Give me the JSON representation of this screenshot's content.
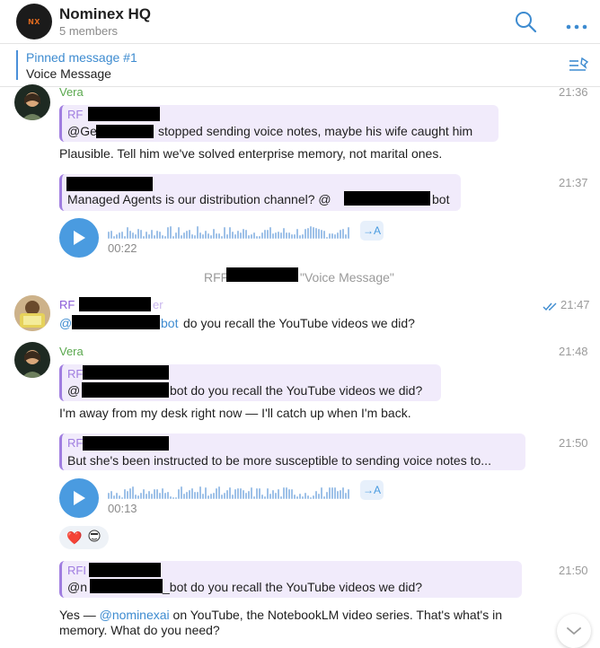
{
  "header": {
    "group_logo": "NX",
    "title": "Nominex HQ",
    "subtitle": "5 members",
    "icons": [
      "search-icon",
      "more-icon"
    ]
  },
  "pinned": {
    "title": "Pinned message #1",
    "text": "Voice Message",
    "icon": "pin-list-icon"
  },
  "messages": {
    "m1": {
      "sender": "Vera",
      "time": "21:36",
      "quote_name": "RF",
      "quote_prefix": "@Ge",
      "quote_text": "stopped sending voice notes, maybe his wife caught him",
      "text": "Plausible. Tell him we've solved enterprise memory, not marital ones."
    },
    "m2": {
      "time": "21:37",
      "quote_text": "Managed Agents is our distribution channel? @",
      "quote_suffix": "bot",
      "voice_duration": "00:22",
      "transcribe": "→A"
    },
    "service": {
      "prefix": "RFF",
      "suffix": "\"Voice Message\""
    },
    "m3": {
      "sender": "RF",
      "sender_tail": "er",
      "time": "21:47",
      "at": "@",
      "mention": "bot",
      "text": "do you recall the YouTube videos we did?"
    },
    "m4": {
      "sender": "Vera",
      "time": "21:48",
      "quote_name": "RF",
      "quote_prefix": "@",
      "quote_text": "bot do you recall the YouTube videos we did?",
      "text": "I'm away from my desk right now — I'll catch up when I'm back."
    },
    "m5": {
      "time": "21:50",
      "quote_name": "RF",
      "quote_text": "But she's been instructed to be more susceptible to sending voice notes to...",
      "voice_duration": "00:13",
      "transcribe": "→A",
      "reactions": [
        "❤️",
        "user-emoji"
      ]
    },
    "m6": {
      "time": "21:50",
      "quote_name": "RFI",
      "quote_prefix": "@n",
      "quote_text": "_bot do you recall the YouTube videos we did?",
      "text_a": "Yes — ",
      "mention": "@nominexai",
      "text_b": " on YouTube, the NotebookLM video series. That's what's in",
      "text_c": "memory. What do you need?"
    }
  },
  "colors": {
    "accent": "#3d8bd0",
    "vera": "#5aa84e",
    "rf": "#8a5ad8",
    "quote_bg": "#f1ebfb"
  }
}
